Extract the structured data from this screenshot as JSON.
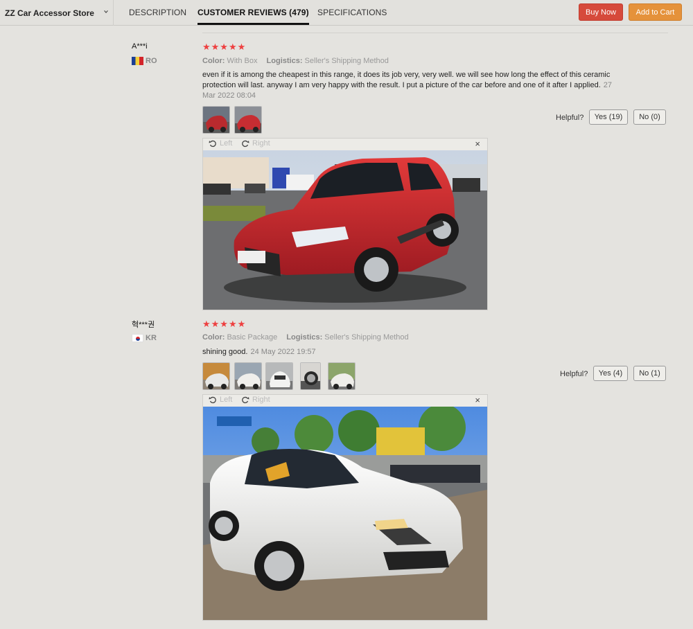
{
  "header": {
    "store_name": "ZZ Car Accessor Store",
    "tabs": [
      "DESCRIPTION",
      "CUSTOMER REVIEWS (479)",
      "SPECIFICATIONS"
    ],
    "buy_now": "Buy Now",
    "add_to_cart": "Add to Cart"
  },
  "colors": {
    "buy_now": "#d64a3b",
    "add_to_cart": "#e5923b",
    "stars": "#ee4040"
  },
  "reviews": [
    {
      "name": "A***i",
      "country": "RO",
      "stars": "★★★★★",
      "color_label": "Color:",
      "color_value": "With Box",
      "logistics_label": "Logistics:",
      "logistics_value": "Seller's Shipping Method",
      "text": "even if it is among the cheapest in this range, it does its job very, very well. we will see how long the effect of this ceramic protection will last. anyway I am very happy with the result. I put a picture of the car before and one of it after I applied.",
      "date": "27 Mar 2022 08:04",
      "helpful": "Helpful?",
      "yes": "Yes (19)",
      "no": "No (0)",
      "viewer": {
        "left": "Left",
        "right": "Right",
        "close": "×"
      }
    },
    {
      "name": "혁***권",
      "country": "KR",
      "stars": "★★★★★",
      "color_label": "Color:",
      "color_value": "Basic Package",
      "logistics_label": "Logistics:",
      "logistics_value": "Seller's Shipping Method",
      "text": "shining good.",
      "date": "24 May 2022 19:57",
      "helpful": "Helpful?",
      "yes": "Yes (4)",
      "no": "No (1)",
      "viewer": {
        "left": "Left",
        "right": "Right",
        "close": "×"
      }
    }
  ]
}
